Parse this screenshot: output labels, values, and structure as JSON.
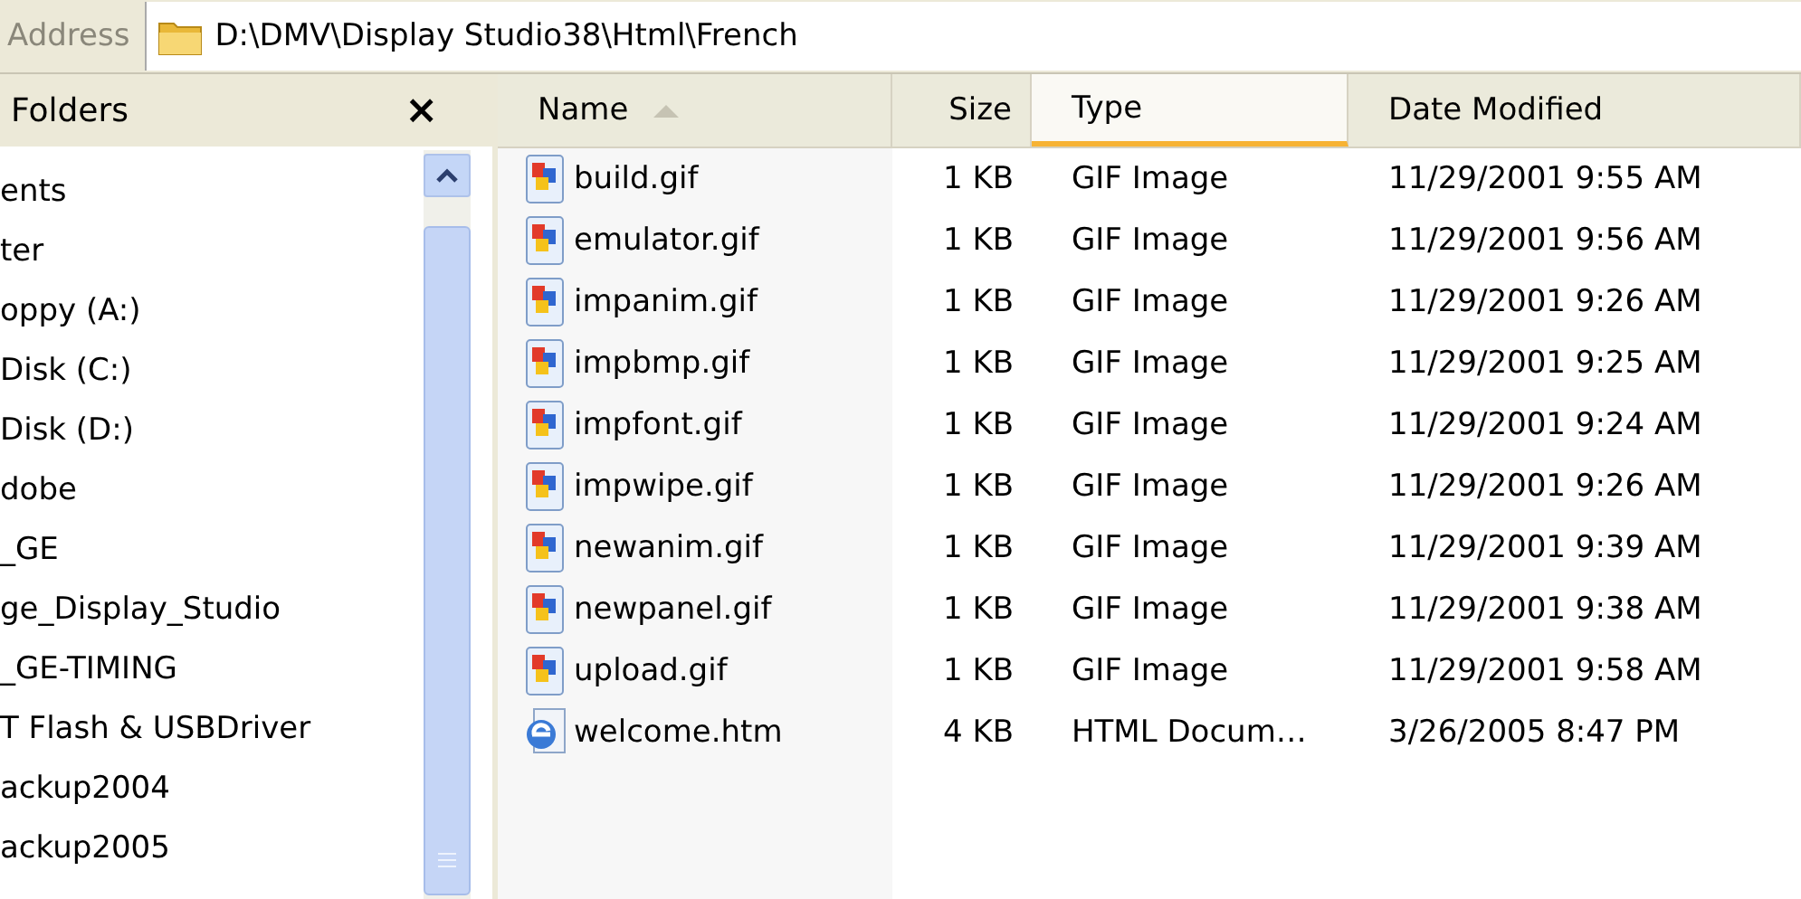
{
  "address_bar": {
    "label": "Address",
    "path": "D:\\DMV\\Display Studio38\\Html\\French"
  },
  "folders_pane": {
    "title": "Folders",
    "close": "×",
    "items": [
      "ents",
      "ter",
      "oppy (A:)",
      "Disk (C:)",
      "Disk (D:)",
      "dobe",
      "_GE",
      "ge_Display_Studio",
      "_GE-TIMING",
      "T Flash & USBDriver",
      "ackup2004",
      "ackup2005"
    ]
  },
  "table": {
    "columns": [
      {
        "label": "Name",
        "sorted": true,
        "hovered": false
      },
      {
        "label": "Size",
        "sorted": false,
        "hovered": false
      },
      {
        "label": "Type",
        "sorted": false,
        "hovered": true
      },
      {
        "label": "Date Modified",
        "sorted": false,
        "hovered": false
      }
    ],
    "rows": [
      {
        "kind": "gif",
        "cells": [
          "build.gif",
          "1 KB",
          "GIF Image",
          "11/29/2001 9:55 AM"
        ]
      },
      {
        "kind": "gif",
        "cells": [
          "emulator.gif",
          "1 KB",
          "GIF Image",
          "11/29/2001 9:56 AM"
        ]
      },
      {
        "kind": "gif",
        "cells": [
          "impanim.gif",
          "1 KB",
          "GIF Image",
          "11/29/2001 9:26 AM"
        ]
      },
      {
        "kind": "gif",
        "cells": [
          "impbmp.gif",
          "1 KB",
          "GIF Image",
          "11/29/2001 9:25 AM"
        ]
      },
      {
        "kind": "gif",
        "cells": [
          "impfont.gif",
          "1 KB",
          "GIF Image",
          "11/29/2001 9:24 AM"
        ]
      },
      {
        "kind": "gif",
        "cells": [
          "impwipe.gif",
          "1 KB",
          "GIF Image",
          "11/29/2001 9:26 AM"
        ]
      },
      {
        "kind": "gif",
        "cells": [
          "newanim.gif",
          "1 KB",
          "GIF Image",
          "11/29/2001 9:39 AM"
        ]
      },
      {
        "kind": "gif",
        "cells": [
          "newpanel.gif",
          "1 KB",
          "GIF Image",
          "11/29/2001 9:38 AM"
        ]
      },
      {
        "kind": "gif",
        "cells": [
          "upload.gif",
          "1 KB",
          "GIF Image",
          "11/29/2001 9:58 AM"
        ]
      },
      {
        "kind": "html",
        "cells": [
          "welcome.htm",
          "4 KB",
          "HTML Docum…",
          "3/26/2005 8:47 PM"
        ]
      }
    ]
  }
}
